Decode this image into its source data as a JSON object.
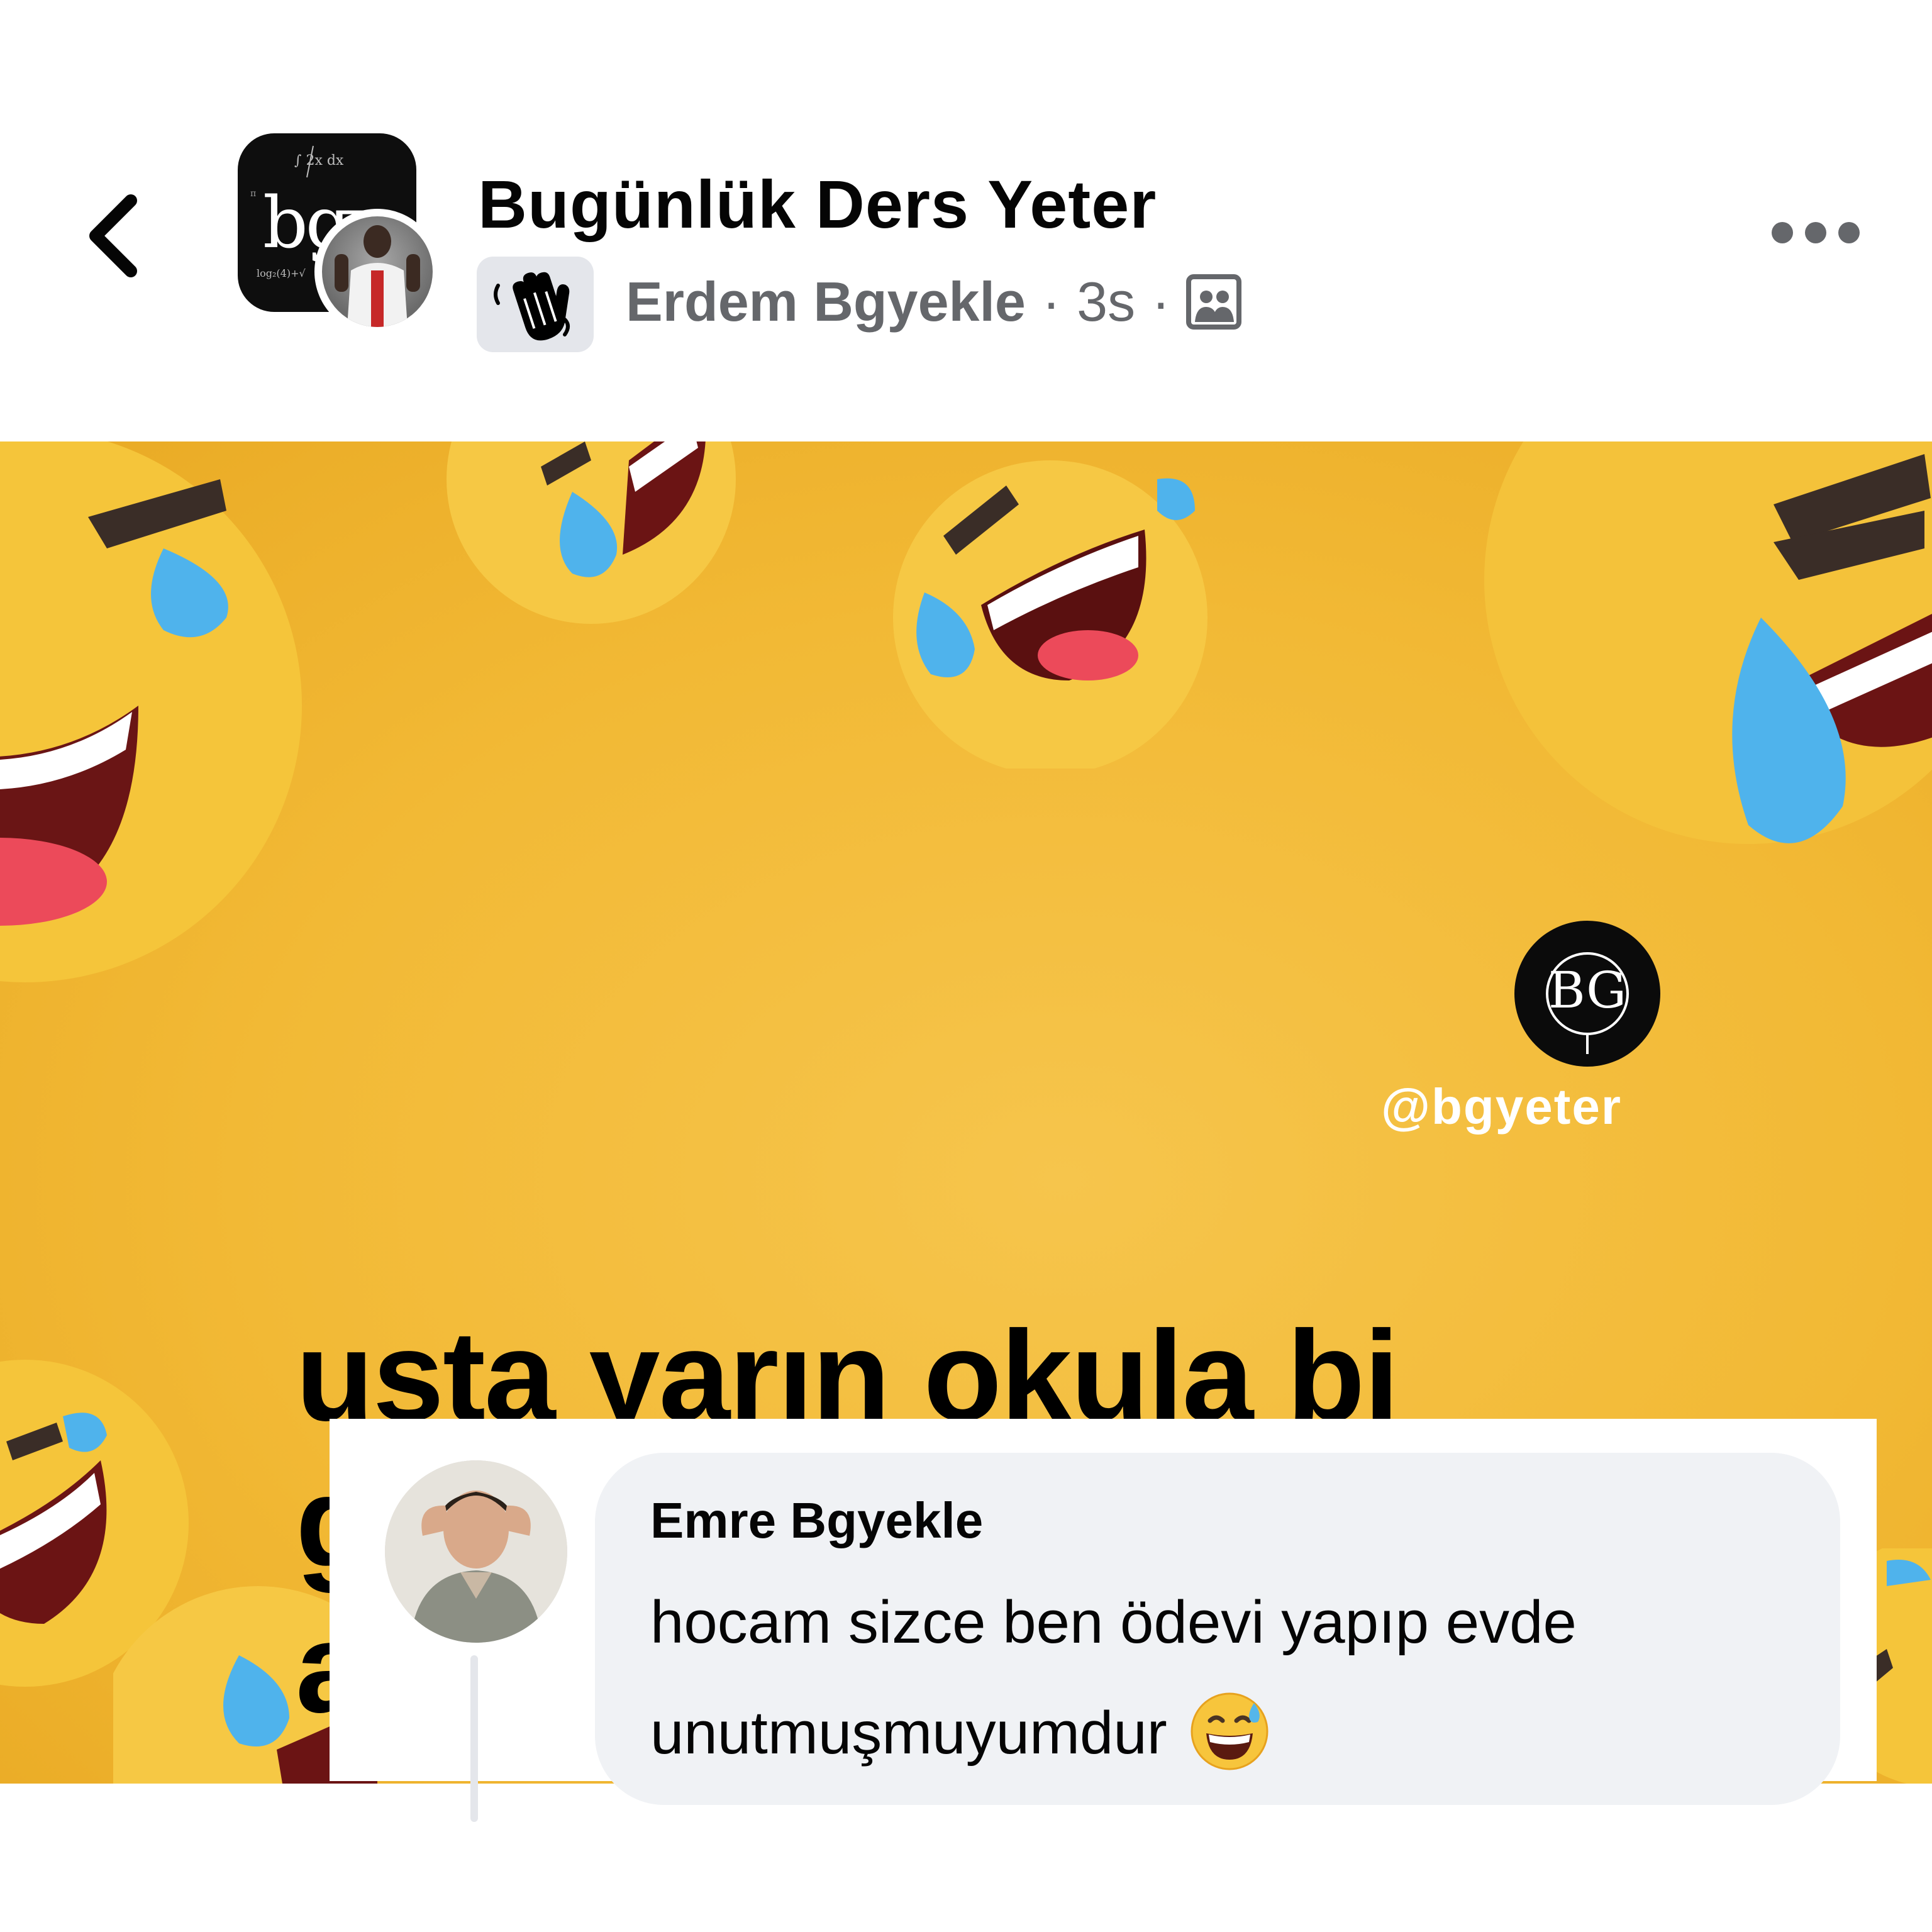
{
  "header": {
    "title": "Bugünlük Ders Yeter",
    "author": "Erdem Bgyekle",
    "separator": "·",
    "time": "3s",
    "group_avatar_text": "bgy",
    "icons": {
      "back": "chevron-left-icon",
      "badge": "waving-hand-icon",
      "audience": "members-icon",
      "more": "more-dots-icon"
    }
  },
  "meme": {
    "handle": "@bgyeter",
    "logo_text": "BG",
    "caption": "usta yarın okula bi\ngitcez herkes uzici\nanimeci bittik valla"
  },
  "comment": {
    "author": "Emre Bgyekle",
    "text": "hocam sizce ben ödevi yapıp evde\nunutmuşmuyumdur",
    "emoji": "😅"
  },
  "colors": {
    "background": "#ffffff",
    "meme_yellow": "#f2b935",
    "text_secondary": "#65676b",
    "bubble": "#f0f2f5"
  }
}
